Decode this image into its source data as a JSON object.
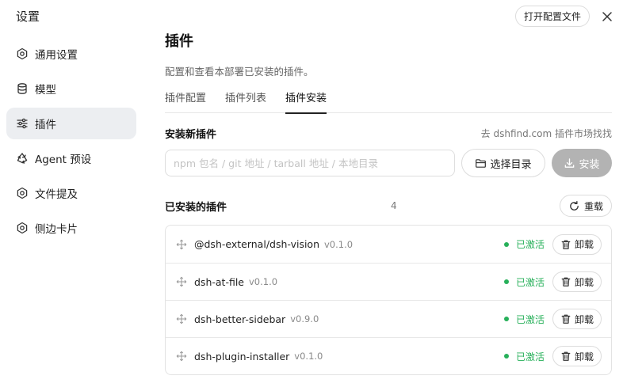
{
  "app": {
    "title": "设置"
  },
  "header": {
    "open_config_label": "打开配置文件"
  },
  "sidebar": {
    "items": [
      {
        "label": "通用设置",
        "icon": "gear-icon"
      },
      {
        "label": "模型",
        "icon": "database-icon"
      },
      {
        "label": "插件",
        "icon": "sliders-icon",
        "active": true
      },
      {
        "label": "Agent 预设",
        "icon": "recycle-icon"
      },
      {
        "label": "文件提及",
        "icon": "gear-icon"
      },
      {
        "label": "侧边卡片",
        "icon": "gear-icon"
      }
    ]
  },
  "main": {
    "title": "插件",
    "subtitle": "配置和查看本部署已安装的插件。",
    "tabs": [
      {
        "label": "插件配置"
      },
      {
        "label": "插件列表"
      },
      {
        "label": "插件安装",
        "active": true
      }
    ],
    "install": {
      "title": "安装新插件",
      "market_link": "去 dshfind.com 插件市场找找",
      "input_placeholder": "npm 包名 / git 地址 / tarball 地址 / 本地目录",
      "input_value": "",
      "choose_dir_label": "选择目录",
      "install_label": "安装"
    },
    "installed": {
      "title": "已安装的插件",
      "count": "4",
      "reload_label": "重载",
      "plugins": [
        {
          "name": "@dsh-external/dsh-vision",
          "version": "v0.1.0",
          "status": "已激活",
          "action": "卸载"
        },
        {
          "name": "dsh-at-file",
          "version": "v0.1.0",
          "status": "已激活",
          "action": "卸载"
        },
        {
          "name": "dsh-better-sidebar",
          "version": "v0.9.0",
          "status": "已激活",
          "action": "卸载"
        },
        {
          "name": "dsh-plugin-installer",
          "version": "v0.1.0",
          "status": "已激活",
          "action": "卸载"
        }
      ]
    }
  },
  "colors": {
    "active_status": "#27b05a",
    "install_button_disabled": "#b3b3b3",
    "sidebar_active_bg": "#eceef1"
  }
}
